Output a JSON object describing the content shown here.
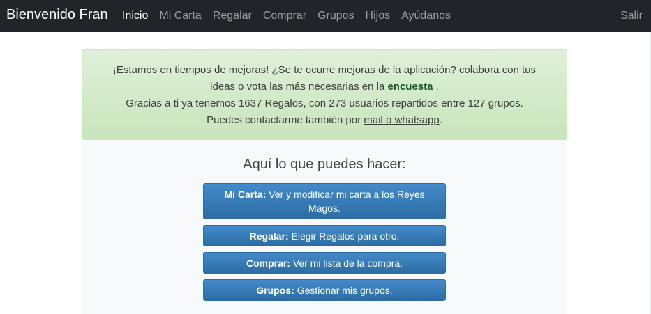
{
  "navbar": {
    "brand": "Bienvenido Fran",
    "links": [
      "Inicio",
      "Mi Carta",
      "Regalar",
      "Comprar",
      "Grupos",
      "Hijos",
      "Ayúdanos"
    ],
    "active": "Inicio",
    "logout": "Salir"
  },
  "alert": {
    "line1": "¡Estamos en tiempos de mejoras! ¿Se te ocurre mejoras de la aplicación? colabora con tus",
    "line2_prefix": "ideas o vota las más necesarias en la ",
    "survey_link": "encuesta",
    "line2_suffix": " .",
    "line3": "Gracias a ti ya tenemos 1637 Regalos, con 273 usuarios repartidos entre 127 grupos.",
    "line4_prefix": "Puedes contactarme también por ",
    "mail_link": "mail",
    "line4_mid": " o",
    "whatsapp_link": " whatsapp",
    "line4_suffix": "."
  },
  "main": {
    "title": "Aquí lo que puedes hacer:",
    "actions": [
      {
        "label": "Mi Carta:",
        "text": " Ver y modificar mi carta a los Reyes Magos."
      },
      {
        "label": "Regalar:",
        "text": " Elegir Regalos para otro."
      },
      {
        "label": "Comprar:",
        "text": " Ver mi lista de la compra."
      },
      {
        "label": "Grupos:",
        "text": " Gestionar mis grupos."
      }
    ]
  },
  "colors": {
    "navbar_bg": "#212529",
    "alert_bg": "#d4edda",
    "button_primary": "#337ab7"
  }
}
